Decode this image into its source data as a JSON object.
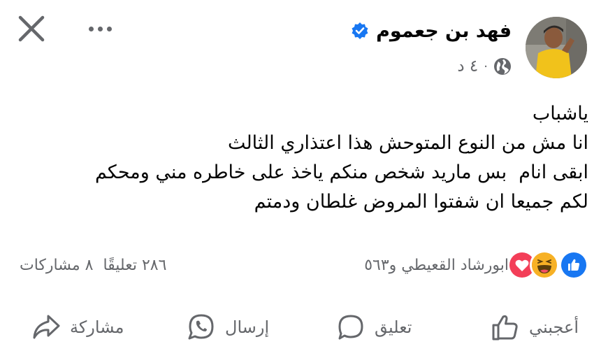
{
  "header": {
    "author_name": "فهد بن جعموم",
    "time": "٤ د",
    "separator": "·"
  },
  "post": {
    "lines": [
      "ياشباب",
      "انا مش من النوع المتوحش هذا اعتذاري الثالث",
      "ابقى انام  بس ماريد شخص منكم ياخذ على خاطره مني ومحكم",
      "لكم جميعا ان شفتوا المروض غلطان ودمتم"
    ]
  },
  "reactions": {
    "reactors_text": "ابورشاد القعيطي و٥٦٣",
    "comments_text": "٢٨٦ تعليقًا",
    "shares_text": "٨ مشاركات"
  },
  "actions": {
    "like": "أعجبني",
    "comment": "تعليق",
    "send": "إرسال",
    "share": "مشاركة"
  },
  "colors": {
    "like_blue": "#1877f2",
    "haha_yellow": "#f7b125",
    "love_red": "#f33e58",
    "secondary_text": "#65676b"
  }
}
